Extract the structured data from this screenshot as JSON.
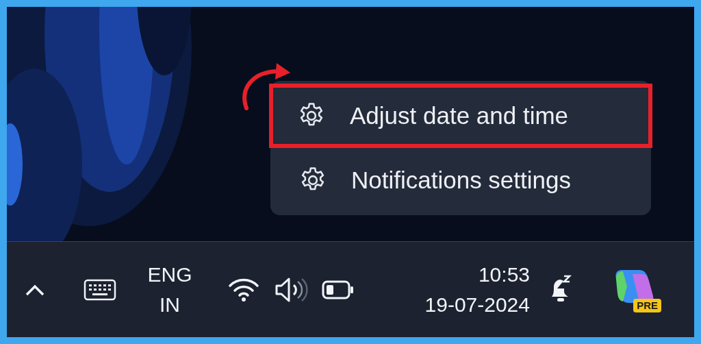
{
  "context_menu": {
    "items": [
      {
        "label": "Adjust date and time",
        "highlighted": true
      },
      {
        "label": "Notifications settings",
        "highlighted": false
      }
    ]
  },
  "taskbar": {
    "language": {
      "line_1": "ENG",
      "line_2": "IN"
    },
    "clock": {
      "time": "10:53",
      "date": "19-07-2024"
    },
    "copilot_badge": "PRE"
  }
}
